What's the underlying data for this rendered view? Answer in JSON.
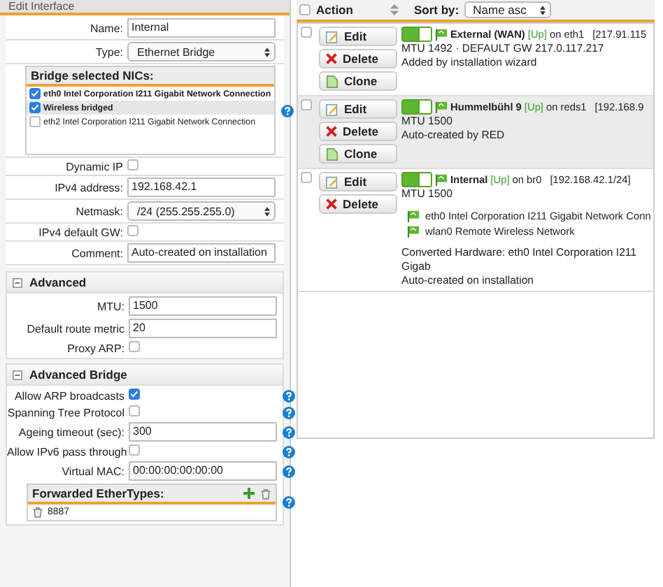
{
  "dialog": {
    "title": "Edit Interface",
    "fields": [
      {
        "kind": "text",
        "label": "Name:",
        "value": "Internal"
      },
      {
        "kind": "select",
        "label": "Type:",
        "value": "Ethernet Bridge"
      },
      {
        "kind": "list",
        "title": "Bridge selected NICs:",
        "help": true,
        "items": [
          {
            "label": "eth0 Intel Corporation I211 Gigabit Network Connection",
            "checked": true,
            "selected": false
          },
          {
            "label": "Wireless bridged",
            "checked": true,
            "selected": true
          },
          {
            "label": "eth2 Intel Corporation I211 Gigabit Network Connection",
            "checked": false,
            "selected": false
          }
        ]
      },
      {
        "kind": "checkbox",
        "label": "Dynamic IP",
        "checked": false
      },
      {
        "kind": "text",
        "label": "IPv4 address:",
        "value": "192.168.42.1"
      },
      {
        "kind": "select",
        "label": "Netmask:",
        "value": "/24 (255.255.255.0)"
      },
      {
        "kind": "checkbox",
        "label": "IPv4 default GW:",
        "checked": false
      },
      {
        "kind": "text",
        "label": "Comment:",
        "value": "Auto-created on installation"
      }
    ],
    "sections": [
      {
        "title": "Advanced",
        "expanded": true,
        "fields": [
          {
            "kind": "text",
            "label": "MTU:",
            "value": "1500"
          },
          {
            "kind": "text",
            "label": "Default route metric",
            "value": "20"
          },
          {
            "kind": "checkbox",
            "label": "Proxy ARP:",
            "checked": false
          }
        ]
      },
      {
        "title": "Advanced Bridge",
        "expanded": true,
        "fields": [
          {
            "kind": "checkbox",
            "label": "Allow ARP broadcasts",
            "checked": true,
            "help": true
          },
          {
            "kind": "checkbox",
            "label": "Spanning Tree Protocol",
            "checked": false,
            "help": true
          },
          {
            "kind": "text",
            "label": "Ageing timeout (sec):",
            "value": "300",
            "help": true
          },
          {
            "kind": "checkbox",
            "label": "Allow IPv6 pass through",
            "checked": false,
            "help": true
          },
          {
            "kind": "text",
            "label": "Virtual MAC:",
            "value": "00:00:00:00:00:00",
            "help": true
          },
          {
            "kind": "editlist",
            "title": "Forwarded EtherTypes:",
            "help": true,
            "items": [
              {
                "label": "8887"
              }
            ]
          }
        ]
      }
    ]
  },
  "list": {
    "all_checked": false,
    "action_label": "Action",
    "sort_label": "Sort by:",
    "sort_value": "Name asc",
    "interfaces": [
      {
        "checked": false,
        "enabled": true,
        "buttons": [
          {
            "kind": "edit",
            "label": "Edit"
          },
          {
            "kind": "delete",
            "label": "Delete"
          },
          {
            "kind": "clone",
            "label": "Clone"
          }
        ],
        "name": "External (WAN)",
        "status": "[Up]",
        "device": "on eth1",
        "address": "[217.91.115",
        "lines": [
          "MTU 1492 · DEFAULT GW 217.0.117.217",
          "Added by installation wizard"
        ]
      },
      {
        "checked": false,
        "enabled": true,
        "buttons": [
          {
            "kind": "edit",
            "label": "Edit"
          },
          {
            "kind": "delete",
            "label": "Delete"
          },
          {
            "kind": "clone",
            "label": "Clone"
          }
        ],
        "name": "Hummelbühl 9",
        "status": "[Up]",
        "device": "on reds1",
        "address": "[192.168.9",
        "lines": [
          "MTU 1500",
          "Auto-created by RED"
        ]
      },
      {
        "checked": false,
        "enabled": true,
        "buttons": [
          {
            "kind": "edit",
            "label": "Edit"
          },
          {
            "kind": "delete",
            "label": "Delete"
          }
        ],
        "name": "Internal",
        "status": "[Up]",
        "device": "on br0",
        "address": "[192.168.42.1/24]",
        "lines": [
          "MTU 1500"
        ],
        "members": [
          "eth0 Intel Corporation I211 Gigabit Network Conn",
          "wlan0 Remote Wireless Network"
        ],
        "footer": [
          "Converted Hardware: eth0 Intel Corporation I211 Gigab",
          "Auto-created on installation"
        ]
      }
    ]
  }
}
